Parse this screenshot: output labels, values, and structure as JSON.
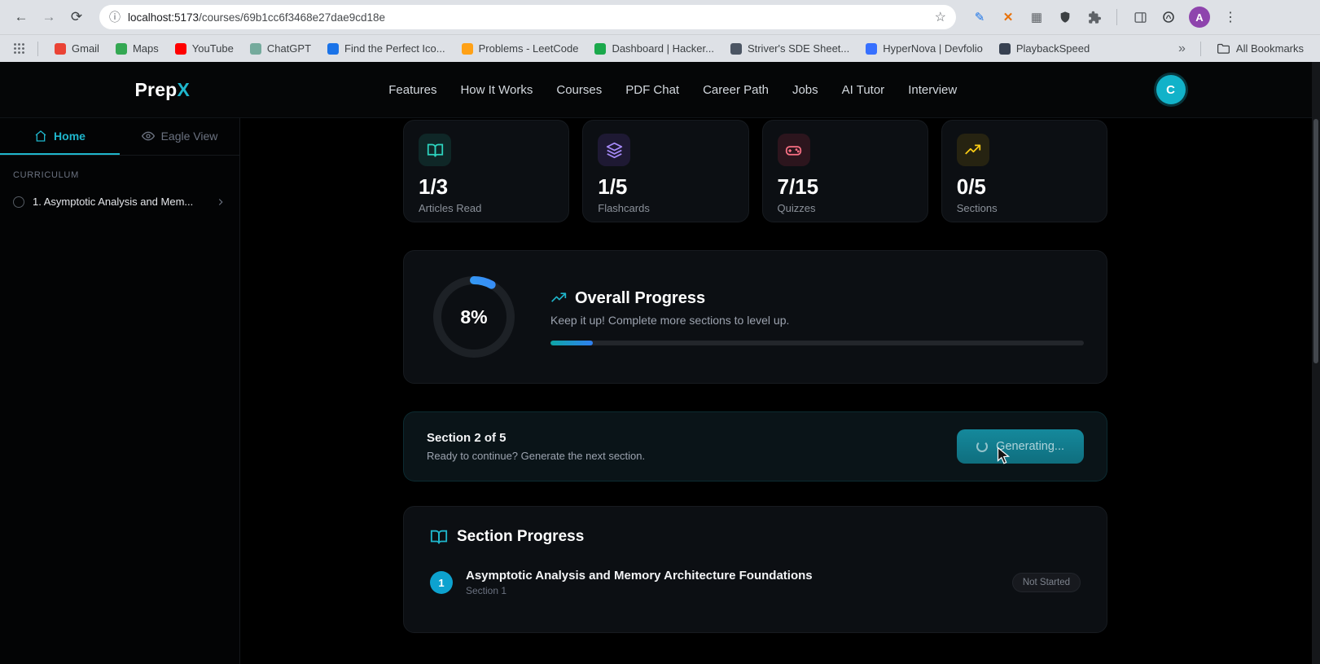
{
  "browser": {
    "url": {
      "host": "localhost:5173",
      "path": "/courses/69b1cc6f3468e27dae9cd18e"
    },
    "glyphs": {
      "back": "←",
      "forward": "→",
      "reload": "⟳",
      "info": "ⓘ",
      "star": "☆",
      "kebab": "⋮",
      "overflow": "»",
      "edit": "✎",
      "close_ext": "✕",
      "grid": "▦",
      "profile_letter": "A"
    },
    "bookmarks": [
      {
        "label": "Gmail",
        "color": "#ea4335"
      },
      {
        "label": "Maps",
        "color": "#34a853"
      },
      {
        "label": "YouTube",
        "color": "#ff0000"
      },
      {
        "label": "ChatGPT",
        "color": "#74aa9c"
      },
      {
        "label": "Find the Perfect Ico...",
        "color": "#1a73e8"
      },
      {
        "label": "Problems - LeetCode",
        "color": "#ffa116"
      },
      {
        "label": "Dashboard | Hacker...",
        "color": "#1ba94c"
      },
      {
        "label": "Striver's SDE Sheet...",
        "color": "#4b5563"
      },
      {
        "label": "HyperNova | Devfolio",
        "color": "#3770ff"
      },
      {
        "label": "PlaybackSpeed",
        "color": "#374151"
      }
    ],
    "all_bookmarks_label": "All Bookmarks"
  },
  "header": {
    "brand_prefix": "Prep",
    "brand_accent": "X",
    "accent_color": "#1fb6cc",
    "nav": [
      "Features",
      "How It Works",
      "Courses",
      "PDF Chat",
      "Career Path",
      "Jobs",
      "AI Tutor",
      "Interview"
    ],
    "avatar_letter": "C"
  },
  "sidebar": {
    "tabs": [
      {
        "label": "Home"
      },
      {
        "label": "Eagle View"
      }
    ],
    "section_label": "CURRICULUM",
    "items": [
      {
        "label": "1. Asymptotic Analysis and Mem..."
      }
    ]
  },
  "stats": [
    {
      "value": "1/3",
      "label": "Articles Read",
      "icon": "book-open-icon",
      "color": "#2dd4bf",
      "icon_bg": "rgba(45,212,191,0.12)"
    },
    {
      "value": "1/5",
      "label": "Flashcards",
      "icon": "layers-icon",
      "color": "#a78bfa",
      "icon_bg": "rgba(139,92,246,0.14)"
    },
    {
      "value": "7/15",
      "label": "Quizzes",
      "icon": "gamepad-icon",
      "color": "#fb7185",
      "icon_bg": "rgba(244,63,94,0.14)"
    },
    {
      "value": "0/5",
      "label": "Sections",
      "icon": "trending-up-icon",
      "color": "#facc15",
      "icon_bg": "rgba(234,179,8,0.12)"
    }
  ],
  "overall_progress": {
    "percent_label": "8%",
    "percent_value": 8,
    "title": "Overall Progress",
    "subtitle": "Keep it up! Complete more sections to level up."
  },
  "next_section": {
    "title": "Section 2 of 5",
    "subtitle": "Ready to continue? Generate the next section.",
    "button_label": "Generating..."
  },
  "section_progress": {
    "title": "Section Progress",
    "items": [
      {
        "number": "1",
        "title": "Asymptotic Analysis and Memory Architecture Foundations",
        "subtitle": "Section 1",
        "status": "Not Started"
      }
    ]
  }
}
